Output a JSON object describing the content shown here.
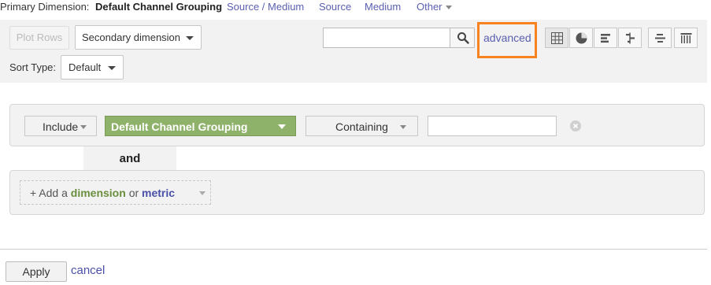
{
  "primary_dimension": {
    "label": "Primary Dimension:",
    "current": "Default Channel Grouping",
    "options": [
      {
        "label": "Source / Medium"
      },
      {
        "label": "Source"
      },
      {
        "label": "Medium"
      },
      {
        "label": "Other"
      }
    ]
  },
  "toolbar": {
    "plot_rows": "Plot Rows",
    "secondary_dimension": "Secondary dimension",
    "sort_type_label": "Sort Type:",
    "sort_type_value": "Default",
    "search_value": "",
    "advanced_link": "advanced",
    "advanced_highlight_color": "#f7821e",
    "view_buttons": [
      {
        "name": "data-table-icon",
        "active": true
      },
      {
        "name": "pie-chart-icon",
        "active": false
      },
      {
        "name": "performance-bar-icon",
        "active": false
      },
      {
        "name": "comparison-icon",
        "active": false
      },
      {
        "name": "term-cloud-icon",
        "active": false
      },
      {
        "name": "pivot-table-icon",
        "active": false
      }
    ]
  },
  "filter": {
    "include": "Include",
    "dimension": "Default Channel Grouping",
    "dimension_color": "#8fb26a",
    "condition": "Containing",
    "value": "",
    "and_label": "and",
    "add": {
      "prefix": "+ Add a",
      "dimension": "dimension",
      "or": "or",
      "metric": "metric"
    }
  },
  "actions": {
    "apply": "Apply",
    "cancel": "cancel"
  }
}
